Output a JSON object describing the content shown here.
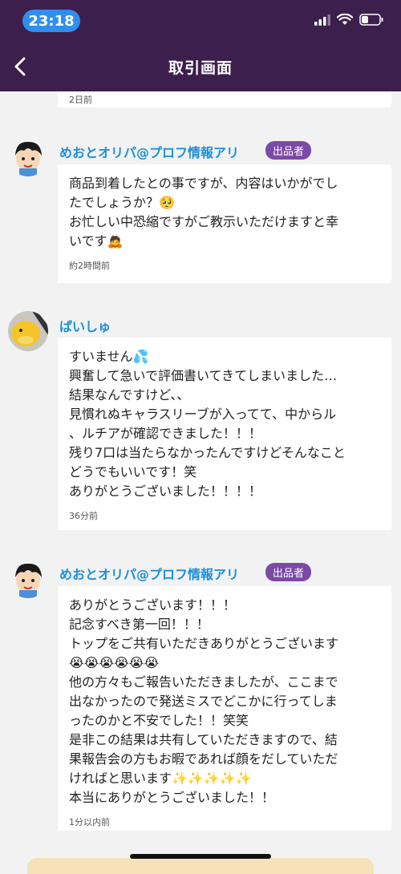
{
  "status_bar": {
    "time": "23:18"
  },
  "header": {
    "title": "取引画面"
  },
  "top_partial": {
    "time": "2日前"
  },
  "messages": [
    {
      "sender": "めおとオリパ@プロフ情報アリ",
      "badge": "出品者",
      "text": "商品到着したとの事ですが、内容はいかがでし\nたでしょうか？🥺\nお忙しい中恐縮ですがご教示いただけますと幸\nいです🙇",
      "time": "約2時間前"
    },
    {
      "sender": "ぱいしゅ",
      "badge": "",
      "text": "すいません💦\n興奮して急いで評価書いてきてしまいました…\n結果なんですけど、、\n見慣れぬキャラスリーブが入ってて、中からル\n、ルチアが確認できました！！！\n残り7口は当たらなかったんですけどそんなこと\nどうでもいいです！笑\nありがとうございました！！！！",
      "time": "36分前"
    },
    {
      "sender": "めおとオリパ@プロフ情報アリ",
      "badge": "出品者",
      "text": "ありがとうございます！！！\n記念すべき第一回！！！\nトップをご共有いただきありがとうございます\n😭😭😭😭😭😭\n他の方々もご報告いただきましたが、ここまで\n出なかったので発送ミスでどこかに行ってしま\nったのかと不安でした！！笑笑\n是非この結果は共有していただきますので、結\n果報告会の方もお暇であれば顔をだしていただ\nければと思います✨✨✨✨✨\n本当にありがとうございました！！",
      "time": "1分以内前"
    }
  ]
}
